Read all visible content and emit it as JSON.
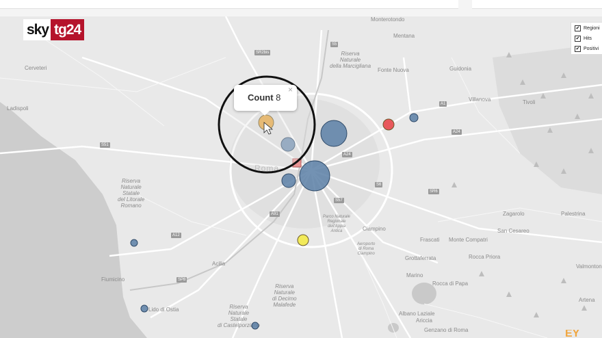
{
  "logo": {
    "sky": "sky",
    "tg": "tg24"
  },
  "legend": {
    "items": [
      {
        "label": "Regioni",
        "checked": true
      },
      {
        "label": "Hits",
        "checked": true
      },
      {
        "label": "Positivi",
        "checked": true
      }
    ]
  },
  "popup": {
    "label": "Count",
    "value": "8",
    "close": "×"
  },
  "watermark": "EY",
  "places": {
    "cerveteri": "Cerveteri",
    "ladispoli": "Ladispoli",
    "monterotondo": "Monterotondo",
    "mentana": "Mentana",
    "fonte_nuova": "Fonte Nuova",
    "guidonia": "Guidonia",
    "villanova": "Villanova",
    "tivoli": "Tivoli",
    "riserva_marcigliana": "Riserva\nNaturale\ndella Marcigliana",
    "riserva_litorale": "Riserva\nNaturale\nStatale\ndel Litorale\nRomano",
    "fiumicino": "Fiumicino",
    "acilia": "Acilia",
    "lido_ostia": "Lido di Ostia",
    "riserva_decimo": "Riserva\nNaturale\ndi Decimo\nMalafede",
    "riserva_castelporziano": "Riserva\nNaturale\nStatale\ndi Castelporziano",
    "parco_appia": "Parco Naturale\nRegionale\ndell'Appia\nAntica",
    "ciampino": "Ciampino",
    "aeroporto": "Aeroporto\ndi Roma\nCiampino",
    "frascati": "Frascati",
    "grottaferrata": "Grottaferrata",
    "monte_compatri": "Monte Compatri",
    "rocca_priora": "Rocca Priora",
    "marino": "Marino",
    "rocca_papa": "Rocca di Papa",
    "albano": "Albano Laziale",
    "ariccia": "Ariccia",
    "genzano": "Genzano di Roma",
    "zagarolo": "Zagarolo",
    "palestrina": "Palestrina",
    "san_cesareo": "San Cesareo",
    "valmontone": "Valmontone",
    "artena": "Artena",
    "roma": "Roma"
  },
  "roads": {
    "sr2bis": "SR2bis",
    "s55": "S5",
    "a1": "A1",
    "a24_1": "A24",
    "a24_2": "A24",
    "s51": "S51",
    "s57": "S57",
    "a91": "A91",
    "a12": "A12",
    "sp8": "SP8",
    "sr6": "SR6",
    "s6": "S6"
  },
  "markers": [
    {
      "name": "marker-positivi-1",
      "kind": "positivi",
      "color": "#5b7fa6"
    },
    {
      "name": "marker-positivi-2",
      "kind": "positivi",
      "color": "#5b7fa6"
    },
    {
      "name": "marker-positivi-3",
      "kind": "positivi",
      "color": "#5b7fa6"
    },
    {
      "name": "marker-positivi-4",
      "kind": "positivi",
      "color": "#5b7fa6"
    },
    {
      "name": "marker-positivi-5",
      "kind": "positivi",
      "color": "#5b7fa6"
    },
    {
      "name": "marker-positivi-6",
      "kind": "positivi",
      "color": "#5b7fa6"
    },
    {
      "name": "marker-positivi-7",
      "kind": "positivi",
      "color": "#5b7fa6"
    },
    {
      "name": "marker-positivi-8",
      "kind": "positivi",
      "color": "#5b7fa6"
    },
    {
      "name": "marker-hit-red",
      "kind": "hits",
      "color": "#e8585c"
    },
    {
      "name": "marker-hit-yellow",
      "kind": "hits",
      "color": "#f2ea5a"
    },
    {
      "name": "marker-selected-orange",
      "kind": "hits",
      "color": "#e6a43a"
    }
  ]
}
